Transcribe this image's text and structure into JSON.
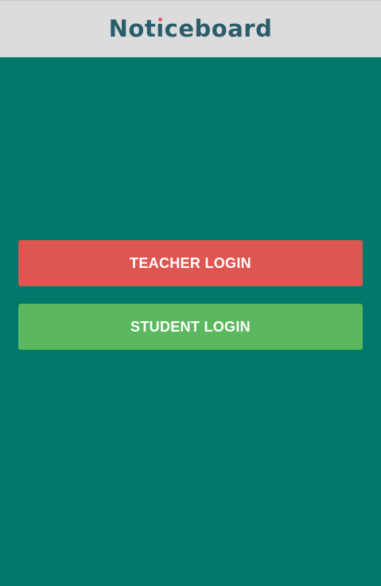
{
  "header": {
    "logo_before": "Not",
    "logo_i": "ı",
    "logo_after": "ceboard",
    "logo_full": "Noticeboard"
  },
  "buttons": {
    "teacher_label": "TEACHER LOGIN",
    "student_label": "STUDENT LOGIN"
  },
  "colors": {
    "background": "#01786a",
    "header_bg": "#dcdcdc",
    "logo_text": "#2a5d6b",
    "logo_dot": "#e85a6a",
    "teacher_button": "#dd5652",
    "student_button": "#5cb85f"
  }
}
